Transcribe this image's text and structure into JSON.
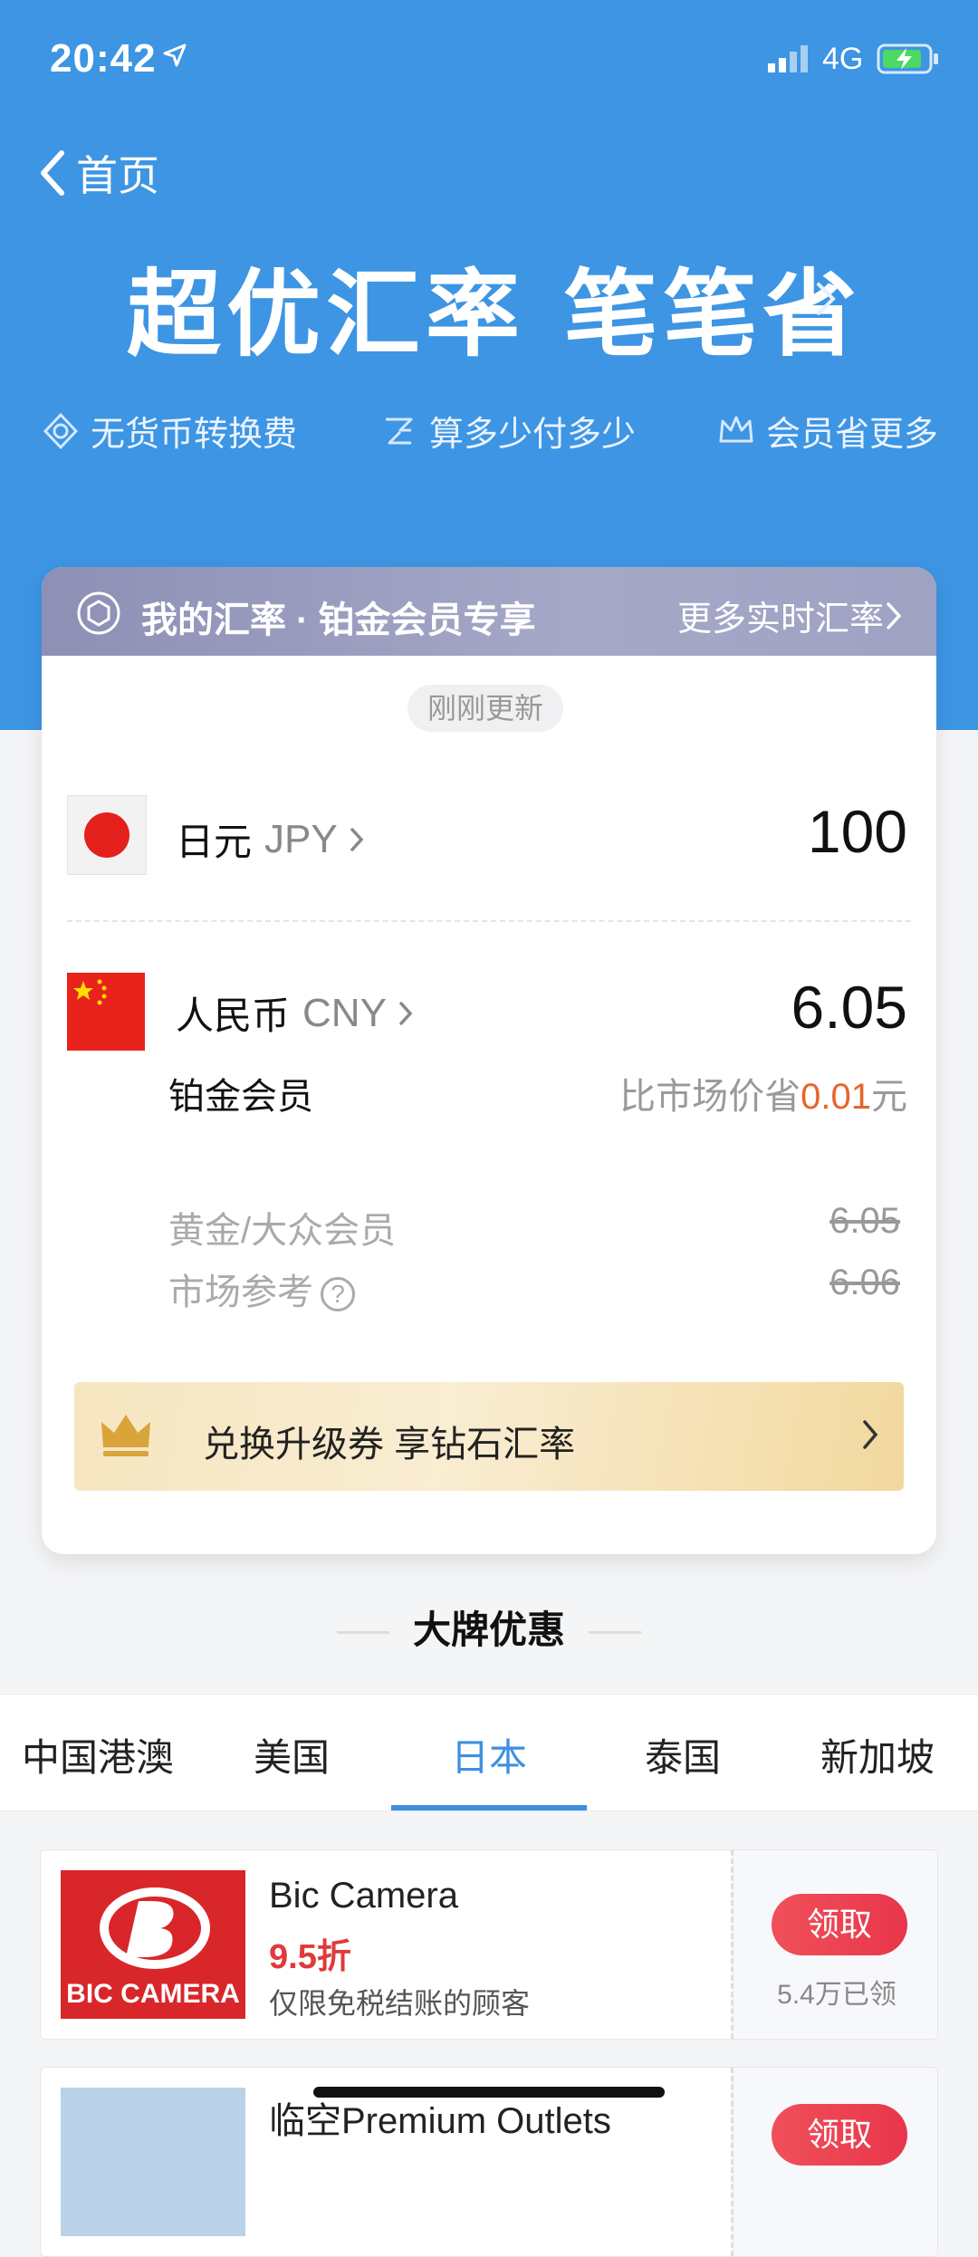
{
  "status_bar": {
    "time": "20:42",
    "network": "4G"
  },
  "nav": {
    "back_label": "首页"
  },
  "banner": {
    "title": "超优汇率 笔笔省"
  },
  "features": [
    {
      "label": "无货币转换费",
      "icon": "shield-check-icon"
    },
    {
      "label": "算多少付多少",
      "icon": "calc-icon"
    },
    {
      "label": "会员省更多",
      "icon": "crown-icon"
    }
  ],
  "rate_card": {
    "header_title": "我的汇率 · 铂金会员专享",
    "header_more": "更多实时汇率",
    "updated": "刚刚更新",
    "from": {
      "name": "日元",
      "code": "JPY",
      "amount": "100",
      "flag": "japan-flag-icon"
    },
    "to": {
      "name": "人民币",
      "code": "CNY",
      "amount": "6.05",
      "flag": "china-flag-icon"
    },
    "tier": "铂金会员",
    "saving_prefix": "比市场价省",
    "saving_value": "0.01",
    "saving_suffix": "元",
    "references": [
      {
        "label": "黄金/大众会员",
        "value": "6.05"
      },
      {
        "label": "市场参考",
        "value": "6.06"
      }
    ],
    "upgrade_label": "兑换升级券 享钻石汇率"
  },
  "brands": {
    "section_title": "大牌优惠",
    "tabs": [
      "中国港澳",
      "美国",
      "日本",
      "泰国",
      "新加坡"
    ],
    "active_tab": "日本",
    "deals": [
      {
        "name": "Bic Camera",
        "discount": "9.5折",
        "condition": "仅限免税结账的顾客",
        "claim": "领取",
        "count": "5.4万已领",
        "logo_text": "BIC CAMERA"
      },
      {
        "name": "临空Premium Outlets",
        "discount": "",
        "condition": "",
        "claim": "领取",
        "count": ""
      }
    ]
  },
  "colors": {
    "brand_blue": "#3d95e3",
    "accent_orange": "#e8652c",
    "claim_red": "#e8364b",
    "tab_active": "#3d8fe0"
  }
}
